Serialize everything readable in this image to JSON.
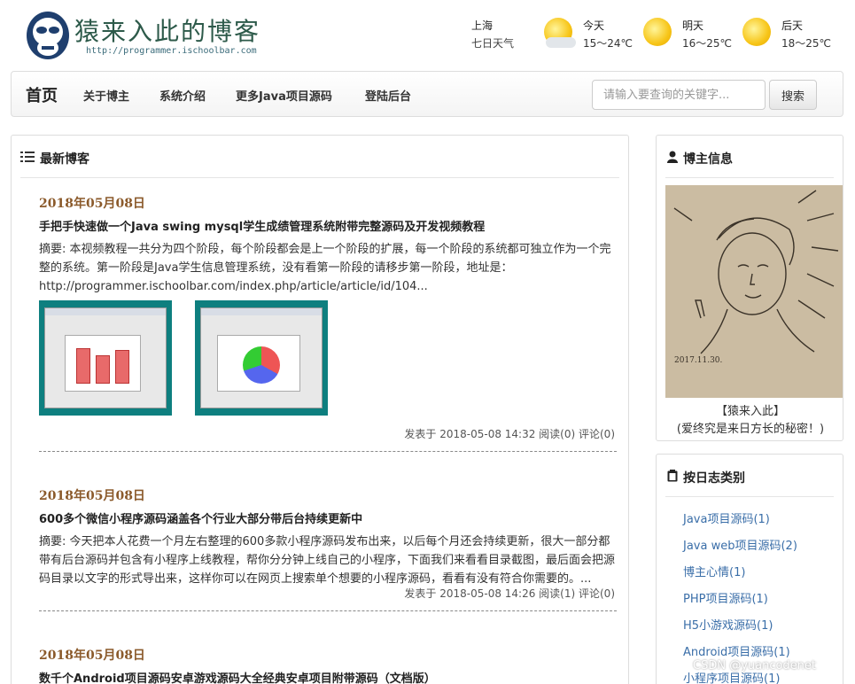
{
  "header": {
    "site_title": "猿来入此的博客",
    "site_url": "http://programmer.ischoolbar.com",
    "weather": {
      "city": "上海",
      "subtitle": "七日天气",
      "days": [
        {
          "name": "今天",
          "temp": "15～24℃",
          "icon": "sun-cloud-icon"
        },
        {
          "name": "明天",
          "temp": "16～25℃",
          "icon": "sun-icon"
        },
        {
          "name": "后天",
          "temp": "18～25℃",
          "icon": "sun-icon"
        }
      ]
    }
  },
  "nav": {
    "brand": "首页",
    "items": [
      "关于博主",
      "系统介绍",
      "更多Java项目源码",
      "登陆后台"
    ],
    "search_placeholder": "请输入要查询的关键字...",
    "search_button": "搜索"
  },
  "main": {
    "heading": "最新博客",
    "posts": [
      {
        "date": "2018年05月08日",
        "title": "手把手快速做一个Java swing mysql学生成绩管理系统附带完整源码及开发视频教程",
        "summary": "摘要: 本视频教程一共分为四个阶段，每个阶段都会是上一个阶段的扩展，每一个阶段的系统都可独立作为一个完整的系统。第一阶段是Java学生信息管理系统，没有看第一阶段的请移步第一阶段，地址是：http://programmer.ischoolbar.com/index.php/article/article/id/104...",
        "meta": "发表于 2018-05-08 14:32 阅读(0) 评论(0)"
      },
      {
        "date": "2018年05月08日",
        "title": "600多个微信小程序源码涵盖各个行业大部分带后台持续更新中",
        "summary": "摘要: 今天把本人花费一个月左右整理的600多款小程序源码发布出来，以后每个月还会持续更新，很大一部分都带有后台源码并包含有小程序上线教程，帮你分分钟上线自己的小程序，下面我们来看看目录截图，最后面会把源码目录以文字的形式导出来，这样你可以在网页上搜索单个想要的小程序源码，看看有没有符合你需要的。...",
        "meta": "发表于 2018-05-08 14:26 阅读(1) 评论(0)"
      },
      {
        "date": "2018年05月08日",
        "title": "数千个Android项目源码安卓游戏源码大全经典安卓项目附带源码（文档版）"
      }
    ]
  },
  "sidebar": {
    "profile": {
      "heading": "博主信息",
      "caption_name": "【猿来入此】",
      "caption_motto": "(爱终究是来日方长的秘密！)",
      "sketch_date": "2017.11.30."
    },
    "categories": {
      "heading": "按日志类别",
      "items": [
        "Java项目源码(1)",
        "Java web项目源码(2)",
        "博主心情(1)",
        "PHP项目源码(1)",
        "H5小游戏源码(1)",
        "Android项目源码(1)",
        "小程序项目源码(1)"
      ]
    }
  },
  "watermark": "CSDN @yuancodenet"
}
